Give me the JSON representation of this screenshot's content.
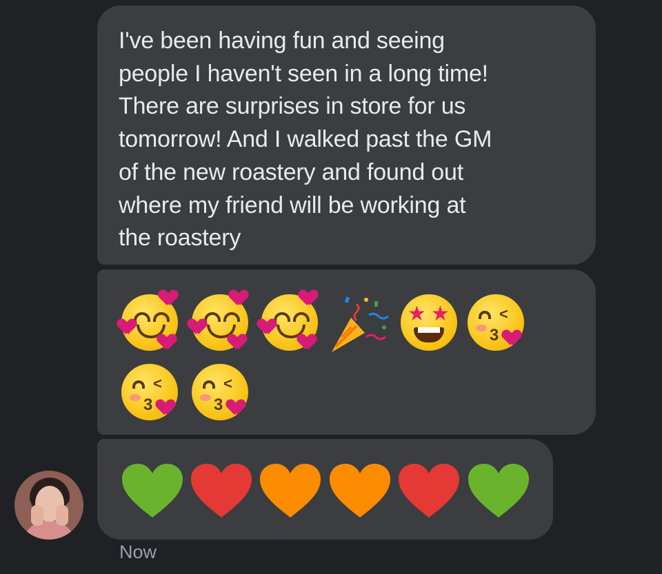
{
  "conversation": {
    "message_text": "I've been having fun and seeing\npeople I haven't seen in a long time!\nThere are surprises in store for us\ntomorrow! And I walked past the GM\nof the new roastery and found out\nwhere my friend will be working at\nthe roastery",
    "emoji_row_1": [
      "smiling-face-with-hearts",
      "smiling-face-with-hearts",
      "smiling-face-with-hearts",
      "party-popper",
      "star-struck",
      "face-blowing-kiss"
    ],
    "emoji_row_2": [
      "face-blowing-kiss",
      "face-blowing-kiss"
    ],
    "hearts": [
      {
        "icon": "green-heart-icon",
        "color": "#6ab42d"
      },
      {
        "icon": "red-heart-icon",
        "color": "#e53935"
      },
      {
        "icon": "orange-heart-icon",
        "color": "#fb8c00"
      },
      {
        "icon": "orange-heart-icon",
        "color": "#fb8c00"
      },
      {
        "icon": "red-heart-icon",
        "color": "#e53935"
      },
      {
        "icon": "green-heart-icon",
        "color": "#6ab42d"
      }
    ],
    "timestamp": "Now"
  },
  "theme": {
    "background": "#202124",
    "bubble": "#3c3d40",
    "text": "#e8eaed",
    "timestamp": "#9aa0a6"
  }
}
